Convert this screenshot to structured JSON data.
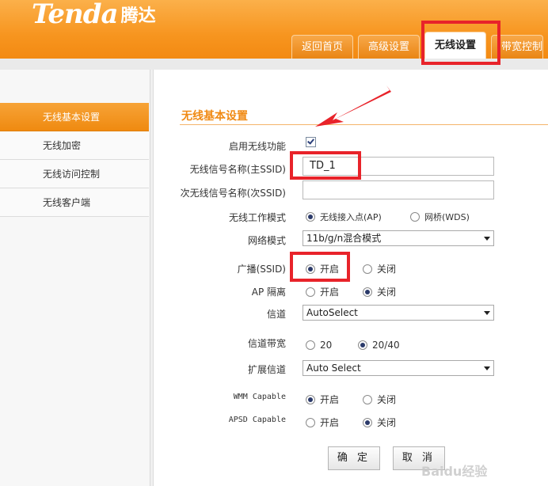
{
  "brand": {
    "logo_text": "Tenda",
    "logo_cn": "腾达"
  },
  "tabs": [
    {
      "label": "返回首页"
    },
    {
      "label": "高级设置"
    },
    {
      "label": "无线设置"
    },
    {
      "label": "带宽控制"
    }
  ],
  "sidebar": {
    "items": [
      {
        "label": "无线基本设置"
      },
      {
        "label": "无线加密"
      },
      {
        "label": "无线访问控制"
      },
      {
        "label": "无线客户端"
      }
    ]
  },
  "form": {
    "title": "无线基本设置",
    "enable_wireless": {
      "label": "启用无线功能",
      "checked": true
    },
    "ssid_primary": {
      "label": "无线信号名称(主SSID)",
      "value": "TD_1"
    },
    "ssid_secondary": {
      "label": "次无线信号名称(次SSID)",
      "value": ""
    },
    "work_mode": {
      "label": "无线工作模式",
      "options": [
        "无线接入点(AP)",
        "网桥(WDS)"
      ],
      "selected": "无线接入点(AP)"
    },
    "network_mode": {
      "label": "网络模式",
      "value": "11b/g/n混合模式"
    },
    "broadcast": {
      "label": "广播(SSID)",
      "options": [
        "开启",
        "关闭"
      ],
      "selected": "开启"
    },
    "ap_isolation": {
      "label": "AP 隔离",
      "options": [
        "开启",
        "关闭"
      ],
      "selected": "关闭"
    },
    "channel": {
      "label": "信道",
      "value": "AutoSelect"
    },
    "bandwidth": {
      "label": "信道带宽",
      "options": [
        "20",
        "20/40"
      ],
      "selected": "20/40"
    },
    "ext_channel": {
      "label": "扩展信道",
      "value": "Auto Select"
    },
    "wmm": {
      "label": "WMM Capable",
      "options": [
        "开启",
        "关闭"
      ],
      "selected": "开启"
    },
    "apsd": {
      "label": "APSD Capable",
      "options": [
        "开启",
        "关闭"
      ],
      "selected": "关闭"
    }
  },
  "buttons": {
    "ok": "确 定",
    "cancel": "取 消"
  },
  "watermark": "Baidu经验",
  "colors": {
    "accent": "#f7951f",
    "highlight": "#e8232a"
  }
}
